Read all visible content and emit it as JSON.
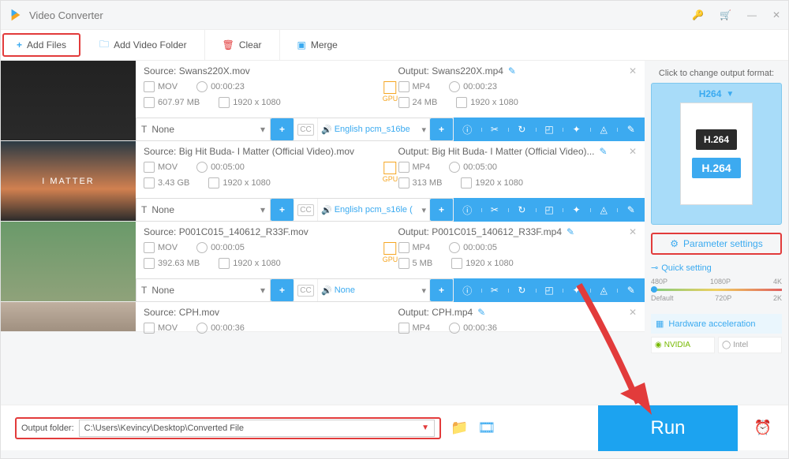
{
  "app": {
    "title": "Video Converter"
  },
  "toolbar": {
    "addFiles": "Add Files",
    "addFolder": "Add Video Folder",
    "clear": "Clear",
    "merge": "Merge"
  },
  "items": [
    {
      "thumbText": "",
      "source": {
        "label": "Source: Swans220X.mov",
        "fmt": "MOV",
        "dur": "00:00:23",
        "size": "607.97 MB",
        "res": "1920 x 1080"
      },
      "output": {
        "label": "Output: Swans220X.mp4",
        "fmt": "MP4",
        "dur": "00:00:23",
        "size": "24 MB",
        "res": "1920 x 1080"
      },
      "subtitle": "None",
      "audio": "English pcm_s16be"
    },
    {
      "thumbText": "I  MATTER",
      "source": {
        "label": "Source: Big Hit Buda- I Matter (Official Video).mov",
        "fmt": "MOV",
        "dur": "00:05:00",
        "size": "3.43 GB",
        "res": "1920 x 1080"
      },
      "output": {
        "label": "Output: Big Hit Buda- I Matter (Official Video)...",
        "fmt": "MP4",
        "dur": "00:05:00",
        "size": "313 MB",
        "res": "1920 x 1080"
      },
      "subtitle": "None",
      "audio": "English pcm_s16le ("
    },
    {
      "thumbText": "",
      "source": {
        "label": "Source: P001C015_140612_R33F.mov",
        "fmt": "MOV",
        "dur": "00:00:05",
        "size": "392.63 MB",
        "res": "1920 x 1080"
      },
      "output": {
        "label": "Output: P001C015_140612_R33F.mp4",
        "fmt": "MP4",
        "dur": "00:00:05",
        "size": "5 MB",
        "res": "1920 x 1080"
      },
      "subtitle": "None",
      "audio": "None"
    },
    {
      "thumbText": "",
      "source": {
        "label": "Source: CPH.mov",
        "fmt": "MOV",
        "dur": "00:00:36",
        "size": "",
        "res": ""
      },
      "output": {
        "label": "Output: CPH.mp4",
        "fmt": "MP4",
        "dur": "00:00:36",
        "size": "",
        "res": ""
      },
      "subtitle": "",
      "audio": ""
    }
  ],
  "side": {
    "hint": "Click to change output format:",
    "format": "H264",
    "codecDark": "H.264",
    "codecBlue": "H.264",
    "param": "Parameter settings",
    "quick": "Quick setting",
    "res": {
      "a": "480P",
      "b": "1080P",
      "c": "4K",
      "d": "Default",
      "e": "720P",
      "f": "2K"
    },
    "hw": "Hardware acceleration",
    "nvidia": "NVIDIA",
    "intel": "Intel"
  },
  "bottom": {
    "label": "Output folder:",
    "path": "C:\\Users\\Kevincy\\Desktop\\Converted File",
    "run": "Run"
  },
  "gpu": "GPU"
}
